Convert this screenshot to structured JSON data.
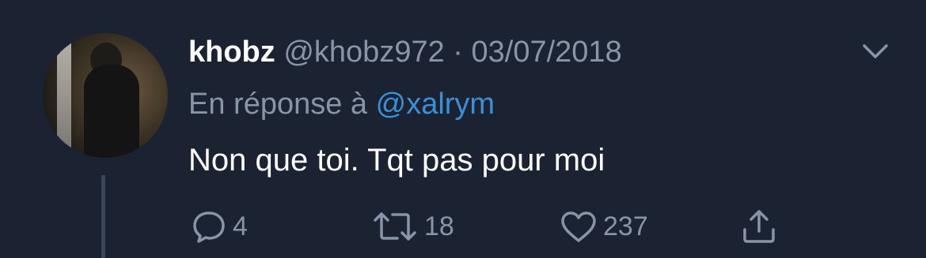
{
  "tweet": {
    "author_name": "khobz",
    "author_handle": "@khobz972",
    "separator": "·",
    "date": "03/07/2018",
    "reply_prefix": "En réponse à",
    "reply_mention": "@xalrym",
    "text": "Non que toi. Tqt pas pour moi"
  },
  "actions": {
    "reply_count": "4",
    "retweet_count": "18",
    "like_count": "237"
  },
  "icons": {
    "reply": "reply-icon",
    "retweet": "retweet-icon",
    "like": "heart-icon",
    "share": "share-icon",
    "menu": "chevron-down-icon"
  },
  "colors": {
    "background": "#1b2232",
    "text_primary": "#ffffff",
    "text_secondary": "#8795a6",
    "mention": "#3b8fd6"
  }
}
